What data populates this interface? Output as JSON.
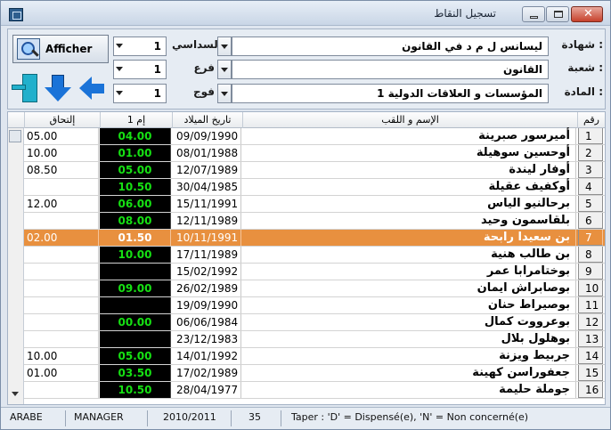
{
  "window": {
    "title": "تسجيل النقاط"
  },
  "header": {
    "search_button_label": "Afficher",
    "fields": {
      "diploma_label": "شهادة :",
      "diploma_value": "ليسانس ل م د في القانون",
      "branch_label": "شعبة :",
      "branch_value": "القانون",
      "subject_label": "المادة :",
      "subject_value": "المؤسسات و العلاقات الدولية 1"
    },
    "selectors": {
      "semester_label": "السداسي",
      "semester_value": "1",
      "section_label": "فرع",
      "section_value": "1",
      "group_label": "فوج",
      "group_value": "1"
    }
  },
  "grid": {
    "columns": [
      "إلتحاق",
      "إم 1",
      "تاريخ الميلاد",
      "الإسم و اللقب",
      "رقم"
    ],
    "rows": [
      {
        "num": "1",
        "name": "أميرسور صبرينة",
        "dob": "09/09/1990",
        "m1": "04.00",
        "ilt": "05.00"
      },
      {
        "num": "2",
        "name": "أوحسين سوهيلة",
        "dob": "08/01/1988",
        "m1": "01.00",
        "ilt": "10.00"
      },
      {
        "num": "3",
        "name": "أوفار ليندة",
        "dob": "12/07/1989",
        "m1": "05.00",
        "ilt": "08.50"
      },
      {
        "num": "4",
        "name": "أوكفيف عقيلة",
        "dob": "30/04/1985",
        "m1": "10.50",
        "ilt": ""
      },
      {
        "num": "5",
        "name": "برحالنيو الياس",
        "dob": "15/11/1991",
        "m1": "06.00",
        "ilt": "12.00"
      },
      {
        "num": "6",
        "name": "بلقاسمون وحيد",
        "dob": "12/11/1989",
        "m1": "08.00",
        "ilt": ""
      },
      {
        "num": "7",
        "name": "بن سعيدا رابحة",
        "dob": "10/11/1991",
        "m1": "01.50",
        "ilt": "02.00",
        "selected": true
      },
      {
        "num": "8",
        "name": "بن طالب هنية",
        "dob": "17/11/1989",
        "m1": "10.00",
        "ilt": ""
      },
      {
        "num": "9",
        "name": "بوختامرابا عمر",
        "dob": "15/02/1992",
        "m1": "",
        "ilt": ""
      },
      {
        "num": "10",
        "name": "بوصابراش ايمان",
        "dob": "26/02/1989",
        "m1": "09.00",
        "ilt": ""
      },
      {
        "num": "11",
        "name": "بوصيراط حنان",
        "dob": "19/09/1990",
        "m1": "",
        "ilt": ""
      },
      {
        "num": "12",
        "name": "بوعرووت كمال",
        "dob": "06/06/1984",
        "m1": "00.00",
        "ilt": ""
      },
      {
        "num": "13",
        "name": "بوهلول بلال",
        "dob": "23/12/1983",
        "m1": "",
        "ilt": ""
      },
      {
        "num": "14",
        "name": "جربيط ويزنة",
        "dob": "14/01/1992",
        "m1": "05.00",
        "ilt": "10.00"
      },
      {
        "num": "15",
        "name": "جعفوراسن كهينة",
        "dob": "17/02/1989",
        "m1": "03.50",
        "ilt": "01.00"
      },
      {
        "num": "16",
        "name": "جوملة حليمة",
        "dob": "28/04/1977",
        "m1": "10.50",
        "ilt": ""
      }
    ]
  },
  "status": {
    "language": "ARABE",
    "user": "MANAGER",
    "year": "2010/2011",
    "count": "35",
    "hint": "Taper : 'D' = Dispensé(e), 'N' = Non concerné(e)"
  },
  "colors": {
    "selected_row": "#e8903f",
    "grade_text": "#16e013",
    "grade_bg": "#000000"
  },
  "icons": [
    "app-icon",
    "search-icon",
    "exit-icon",
    "arrow-down-icon",
    "arrow-left-icon"
  ]
}
